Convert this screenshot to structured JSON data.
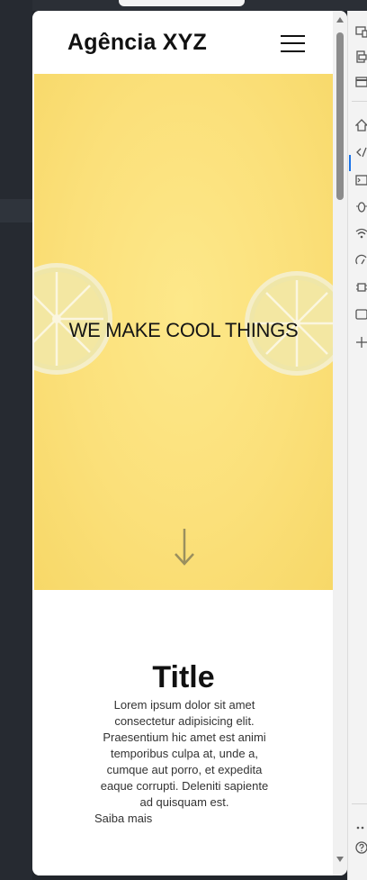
{
  "site": {
    "brand": "Agência XYZ",
    "menu_icon": "hamburger-menu-icon"
  },
  "hero": {
    "headline": "WE MAKE COOL THINGS",
    "scroll_icon": "arrow-down-icon"
  },
  "content": {
    "title": "Title",
    "body": "Lorem ipsum dolor sit amet consectetur adipisicing elit. Praesentium hic amet est animi temporibus culpa at, unde a, cumque aut porro, et expedita eaque corrupti. Deleniti sapiente ad quisquam est.",
    "link": "Saiba mais"
  },
  "devtools_toolbar": {
    "icons": [
      "device-toggle-icon",
      "inspect-icon",
      "window-icon",
      "home-icon",
      "code-icon",
      "console-icon",
      "bug-icon",
      "wifi-icon",
      "performance-icon",
      "memory-icon",
      "application-icon",
      "add-tool-icon",
      "more-icon",
      "help-icon"
    ]
  },
  "colors": {
    "hero_yellow": "#fbe07a",
    "text_dark": "#111111",
    "accent_blue": "#1a73e8"
  }
}
